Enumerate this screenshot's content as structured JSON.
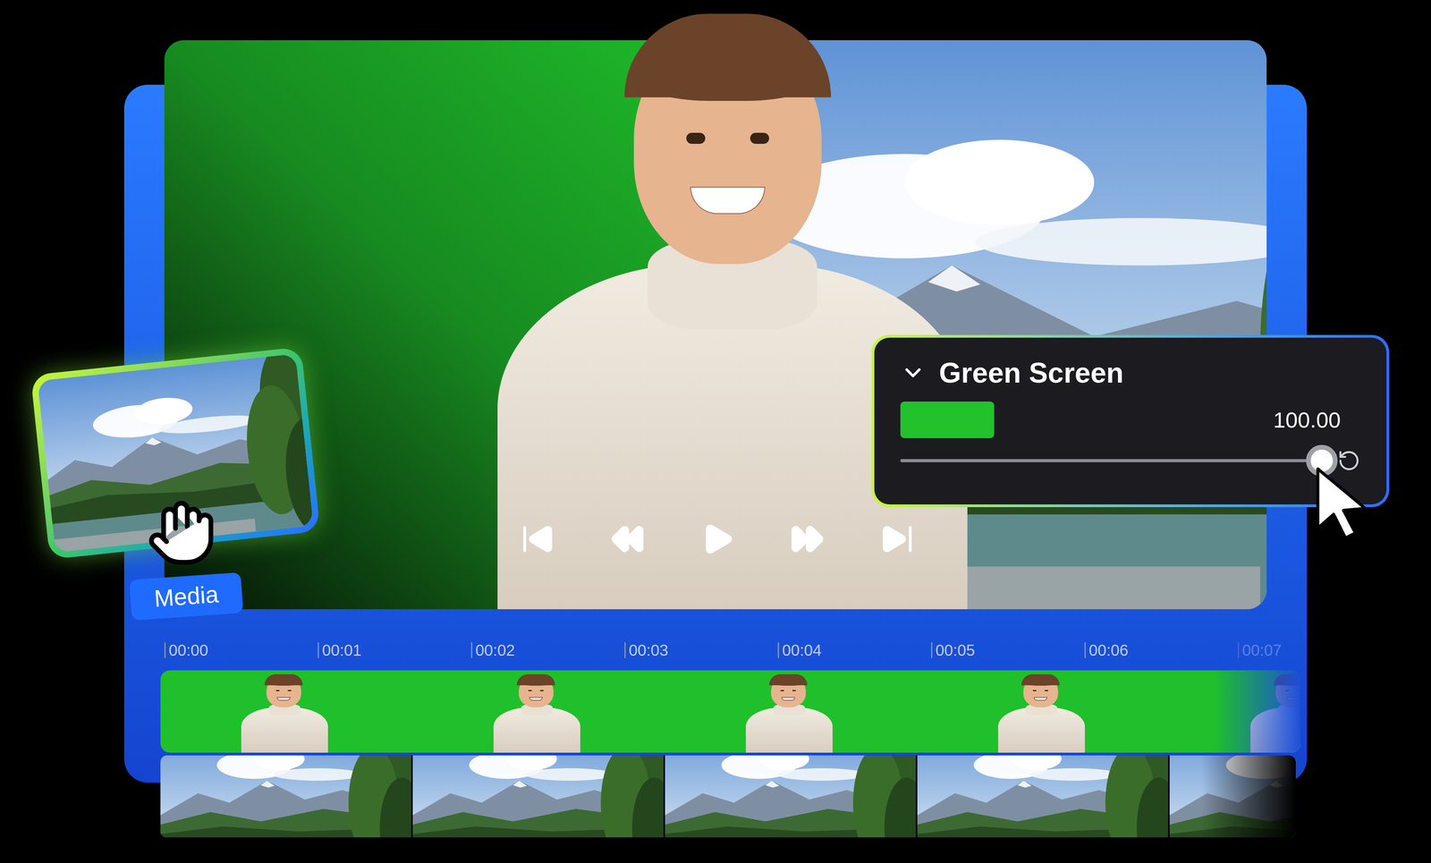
{
  "player": {
    "playing": false
  },
  "media_card": {
    "label": "Media"
  },
  "green_screen_panel": {
    "title": "Green Screen",
    "expanded": true,
    "value": "100.00",
    "level": 1.0
  },
  "timeline": {
    "ticks": [
      "00:00",
      "00:01",
      "00:02",
      "00:03",
      "00:04",
      "00:05",
      "00:06",
      "00:07"
    ]
  }
}
